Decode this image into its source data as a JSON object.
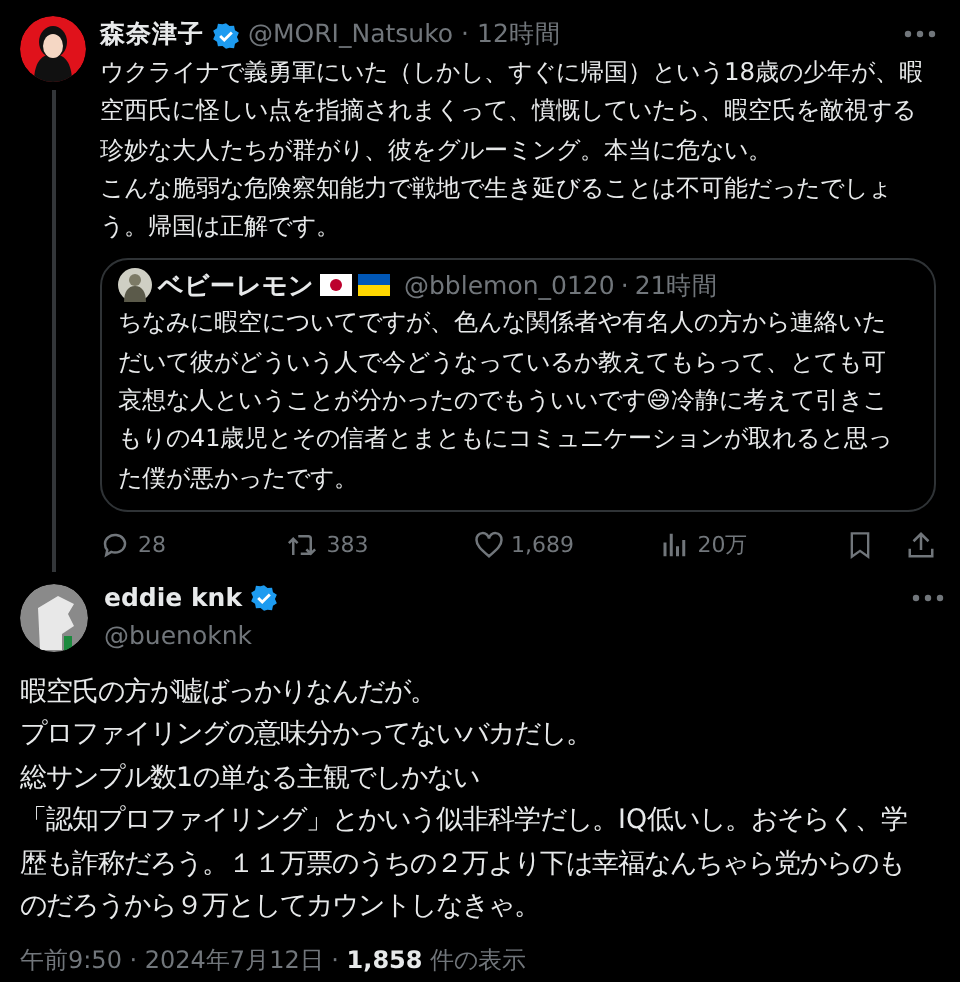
{
  "tweet": {
    "author": "森奈津子",
    "verified": true,
    "handle": "@MORI_Natsuko",
    "separator": "·",
    "time": "12時間",
    "paragraphs": [
      "ウクライナで義勇軍にいた（しかし、すぐに帰国）という18歳の少年が、暇空西氏に怪しい点を指摘されまくって、憤慨していたら、暇空氏を敵視する珍妙な大人たちが群がり、彼をグルーミング。本当に危ない。",
      "こんな脆弱な危険察知能力で戦地で生き延びることは不可能だったでしょう。帰国は正解です。"
    ],
    "quote": {
      "author": "ベビーレモン",
      "handle": "@bblemon_0120",
      "separator": "·",
      "time": "21時間",
      "text": "ちなみに暇空についてですが、色んな関係者や有名人の方から連絡いただいて彼がどういう人で今どうなっているか教えてもらって、とても可哀想な人ということが分かったのでもういいです😅冷静に考えて引きこもりの41歳児とその信者とまともにコミュニケーションが取れると思った僕が悪かったです。"
    },
    "stats": [
      {
        "kind": "reply",
        "count": "28"
      },
      {
        "kind": "repost",
        "count": "383"
      },
      {
        "kind": "like",
        "count": "1,689"
      },
      {
        "kind": "views",
        "count": "20万"
      }
    ]
  },
  "reply": {
    "author": "eddie knk",
    "verified": true,
    "handle": "@buenoknk",
    "paragraphs": [
      "暇空氏の方が嘘ばっかりなんだが。",
      "プロファイリングの意味分かってないバカだし。",
      "総サンプル数1の単なる主観でしかない",
      "「認知プロファイリング」とかいう似非科学だし。IQ低いし。おそらく、学歴も詐称だろう。１１万票のうちの２万より下は幸福なんちゃら党からのものだろうから９万としてカウントしなきゃ。"
    ],
    "footer": "午前9:50 · 2024年7月12日 · **1,858** 件の表示"
  }
}
